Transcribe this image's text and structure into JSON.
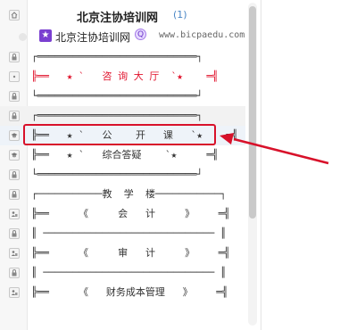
{
  "header": {
    "title": "北京注协培训网",
    "count": "(1)"
  },
  "subrow": {
    "badge_icon": "graduation-icon",
    "name": "北京注协培训网",
    "badge": "Q",
    "url": "www.bicpaedu.com"
  },
  "rows": [
    {
      "icon": "lock-icon",
      "text": "┌═══════════════════════════┐",
      "color": "dark"
    },
    {
      "icon": "dot-icon",
      "text": "╠══   ★ `   咨 询 大 厅  `★    ═╣",
      "color": "red"
    },
    {
      "icon": "lock-icon",
      "text": "└═══════════════════════════┘",
      "color": "dark"
    },
    {
      "icon": "lock-icon",
      "text": "┌═══════════════════════════┐",
      "color": "dark"
    },
    {
      "icon": "cap-icon",
      "text": "╠══   ★ `   公    开   课   `★    ═╣",
      "color": "dark"
    },
    {
      "icon": "cap-icon",
      "text": "╠══   ★ `   综合答疑    `★     ═╣",
      "color": "dark"
    },
    {
      "icon": "lock-icon",
      "text": "└═══════════════════════════┘",
      "color": "dark"
    },
    {
      "icon": "lock-icon",
      "text": "┌───────────教  学  楼───────────┐",
      "color": "dark"
    },
    {
      "icon": "people-icon",
      "text": "╠══     《     会   计     》    ═╣",
      "color": "dark"
    },
    {
      "icon": "lock-icon",
      "text": "║ ───────────────────────────── ║",
      "color": "dark"
    },
    {
      "icon": "people-icon",
      "text": "╠══     《     审   计     》    ═╣",
      "color": "dark"
    },
    {
      "icon": "lock-icon",
      "text": "║ ───────────────────────────── ║",
      "color": "dark"
    },
    {
      "icon": "people-icon",
      "text": "╠══     《   财务成本管理   》    ═╣",
      "color": "dark"
    }
  ],
  "colors": {
    "accent_red": "#e0102a",
    "highlight_border": "#d8112a",
    "count_blue": "#4a86c5"
  }
}
